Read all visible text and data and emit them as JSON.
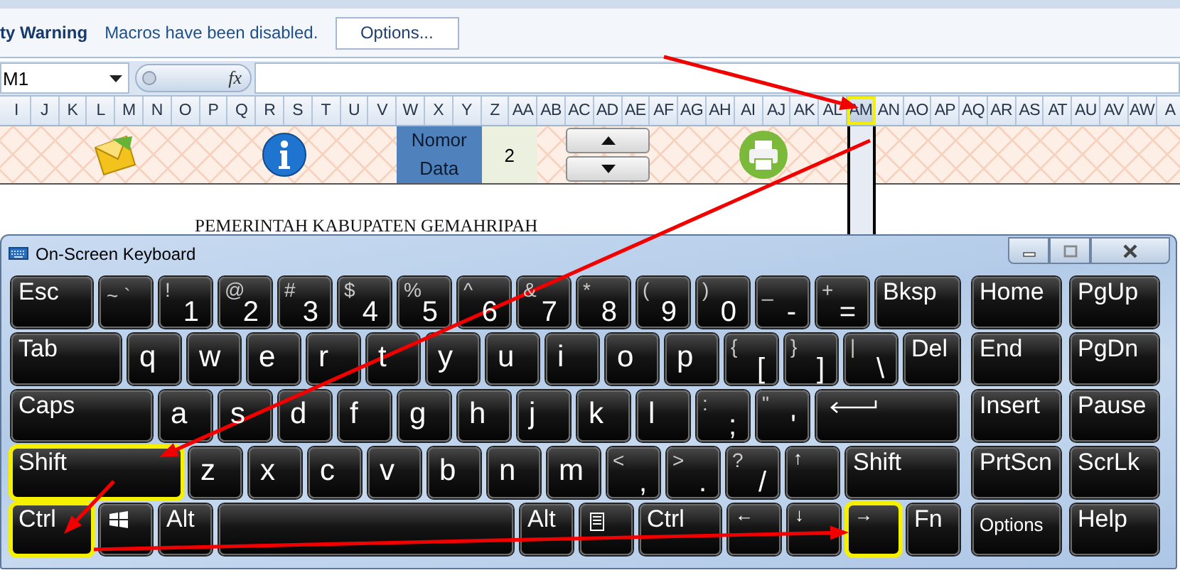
{
  "security_bar": {
    "title": "ty Warning",
    "message": "Macros have been disabled.",
    "button": "Options..."
  },
  "formula_bar": {
    "name_box": "M1",
    "function_label": "fx"
  },
  "column_headers": [
    {
      "label": "I",
      "selected": false,
      "highlighted": false
    },
    {
      "label": "J",
      "selected": false,
      "highlighted": false
    },
    {
      "label": "K",
      "selected": false,
      "highlighted": false
    },
    {
      "label": "L",
      "selected": false,
      "highlighted": false
    },
    {
      "label": "M",
      "selected": false,
      "highlighted": false
    },
    {
      "label": "N",
      "selected": false,
      "highlighted": false
    },
    {
      "label": "O",
      "selected": false,
      "highlighted": false
    },
    {
      "label": "P",
      "selected": false,
      "highlighted": false
    },
    {
      "label": "Q",
      "selected": false,
      "highlighted": false
    },
    {
      "label": "R",
      "selected": false,
      "highlighted": false
    },
    {
      "label": "S",
      "selected": false,
      "highlighted": false
    },
    {
      "label": "T",
      "selected": false,
      "highlighted": false
    },
    {
      "label": "U",
      "selected": false,
      "highlighted": false
    },
    {
      "label": "V",
      "selected": false,
      "highlighted": false
    },
    {
      "label": "W",
      "selected": false,
      "highlighted": false
    },
    {
      "label": "X",
      "selected": false,
      "highlighted": false
    },
    {
      "label": "Y",
      "selected": false,
      "highlighted": false
    },
    {
      "label": "Z",
      "selected": false,
      "highlighted": false
    },
    {
      "label": "AA",
      "selected": false,
      "highlighted": false
    },
    {
      "label": "AB",
      "selected": false,
      "highlighted": false
    },
    {
      "label": "AC",
      "selected": false,
      "highlighted": false
    },
    {
      "label": "AD",
      "selected": false,
      "highlighted": false
    },
    {
      "label": "AE",
      "selected": false,
      "highlighted": false
    },
    {
      "label": "AF",
      "selected": false,
      "highlighted": false
    },
    {
      "label": "AG",
      "selected": false,
      "highlighted": false
    },
    {
      "label": "AH",
      "selected": false,
      "highlighted": false
    },
    {
      "label": "AI",
      "selected": false,
      "highlighted": false
    },
    {
      "label": "AJ",
      "selected": false,
      "highlighted": false
    },
    {
      "label": "AK",
      "selected": false,
      "highlighted": false
    },
    {
      "label": "AL",
      "selected": false,
      "highlighted": false
    },
    {
      "label": "AM",
      "selected": true,
      "highlighted": true
    },
    {
      "label": "AN",
      "selected": false,
      "highlighted": false
    },
    {
      "label": "AO",
      "selected": false,
      "highlighted": false
    },
    {
      "label": "AP",
      "selected": false,
      "highlighted": false
    },
    {
      "label": "AQ",
      "selected": false,
      "highlighted": false
    },
    {
      "label": "AR",
      "selected": false,
      "highlighted": false
    },
    {
      "label": "AS",
      "selected": false,
      "highlighted": false
    },
    {
      "label": "AT",
      "selected": false,
      "highlighted": false
    },
    {
      "label": "AU",
      "selected": false,
      "highlighted": false
    },
    {
      "label": "AV",
      "selected": false,
      "highlighted": false
    },
    {
      "label": "AW",
      "selected": false,
      "highlighted": false
    },
    {
      "label": "A",
      "selected": false,
      "highlighted": false
    }
  ],
  "toolbar_row": {
    "nomor_label": "Nomor Data",
    "nomor_value": "2"
  },
  "document_title": "PEMERINTAH KABUPATEN GEMAHRIPAH",
  "keyboard": {
    "title": "On-Screen Keyboard",
    "main_rows": [
      {
        "keys": [
          {
            "kind": "label",
            "label": "Esc",
            "highlighted": false
          },
          {
            "kind": "inline",
            "shift": "~",
            "label": "`",
            "highlighted": false
          },
          {
            "kind": "symbol",
            "shift": "!",
            "label": "1",
            "highlighted": false
          },
          {
            "kind": "symbol",
            "shift": "@",
            "label": "2",
            "highlighted": false
          },
          {
            "kind": "symbol",
            "shift": "#",
            "label": "3",
            "highlighted": false
          },
          {
            "kind": "symbol",
            "shift": "$",
            "label": "4",
            "highlighted": false
          },
          {
            "kind": "symbol",
            "shift": "%",
            "label": "5",
            "highlighted": false
          },
          {
            "kind": "symbol",
            "shift": "^",
            "label": "6",
            "highlighted": false
          },
          {
            "kind": "symbol",
            "shift": "&",
            "label": "7",
            "highlighted": false
          },
          {
            "kind": "symbol",
            "shift": "*",
            "label": "8",
            "highlighted": false
          },
          {
            "kind": "symbol",
            "shift": "(",
            "label": "9",
            "highlighted": false
          },
          {
            "kind": "symbol",
            "shift": ")",
            "label": "0",
            "highlighted": false
          },
          {
            "kind": "symbol",
            "shift": "_",
            "label": "-",
            "highlighted": false
          },
          {
            "kind": "symbol",
            "shift": "+",
            "label": "=",
            "highlighted": false
          },
          {
            "kind": "label",
            "label": "Bksp",
            "highlighted": false
          }
        ]
      },
      {
        "keys": [
          {
            "kind": "label",
            "label": "Tab",
            "highlighted": false
          },
          {
            "kind": "letter",
            "label": "q",
            "highlighted": false
          },
          {
            "kind": "letter",
            "label": "w",
            "highlighted": false
          },
          {
            "kind": "letter",
            "label": "e",
            "highlighted": false
          },
          {
            "kind": "letter",
            "label": "r",
            "highlighted": false
          },
          {
            "kind": "letter",
            "label": "t",
            "highlighted": false
          },
          {
            "kind": "letter",
            "label": "y",
            "highlighted": false
          },
          {
            "kind": "letter",
            "label": "u",
            "highlighted": false
          },
          {
            "kind": "letter",
            "label": "i",
            "highlighted": false
          },
          {
            "kind": "letter",
            "label": "o",
            "highlighted": false
          },
          {
            "kind": "letter",
            "label": "p",
            "highlighted": false
          },
          {
            "kind": "symbol",
            "shift": "{",
            "label": "[",
            "highlighted": false
          },
          {
            "kind": "symbol",
            "shift": "}",
            "label": "]",
            "highlighted": false
          },
          {
            "kind": "symbol",
            "shift": "|",
            "label": "\\",
            "highlighted": false
          },
          {
            "kind": "label",
            "label": "Del",
            "highlighted": false
          }
        ]
      },
      {
        "keys": [
          {
            "kind": "label",
            "label": "Caps",
            "highlighted": false
          },
          {
            "kind": "letter",
            "label": "a",
            "highlighted": false
          },
          {
            "kind": "letter",
            "label": "s",
            "highlighted": false
          },
          {
            "kind": "letter",
            "label": "d",
            "highlighted": false
          },
          {
            "kind": "letter",
            "label": "f",
            "highlighted": false
          },
          {
            "kind": "letter",
            "label": "g",
            "highlighted": false
          },
          {
            "kind": "letter",
            "label": "h",
            "highlighted": false
          },
          {
            "kind": "letter",
            "label": "j",
            "highlighted": false
          },
          {
            "kind": "letter",
            "label": "k",
            "highlighted": false
          },
          {
            "kind": "letter",
            "label": "l",
            "highlighted": false
          },
          {
            "kind": "symbol",
            "shift": ":",
            "label": ";",
            "highlighted": false
          },
          {
            "kind": "symbol",
            "shift": "\"",
            "label": "'",
            "highlighted": false
          },
          {
            "kind": "enter",
            "highlighted": false
          }
        ]
      },
      {
        "keys": [
          {
            "kind": "label",
            "label": "Shift",
            "highlighted": true
          },
          {
            "kind": "letter",
            "label": "z",
            "highlighted": false
          },
          {
            "kind": "letter",
            "label": "x",
            "highlighted": false
          },
          {
            "kind": "letter",
            "label": "c",
            "highlighted": false
          },
          {
            "kind": "letter",
            "label": "v",
            "highlighted": false
          },
          {
            "kind": "letter",
            "label": "b",
            "highlighted": false
          },
          {
            "kind": "letter",
            "label": "n",
            "highlighted": false
          },
          {
            "kind": "letter",
            "label": "m",
            "highlighted": false
          },
          {
            "kind": "symbol",
            "shift": "<",
            "label": ",",
            "highlighted": false
          },
          {
            "kind": "symbol",
            "shift": ">",
            "label": ".",
            "highlighted": false
          },
          {
            "kind": "symbol",
            "shift": "?",
            "label": "/",
            "highlighted": false
          },
          {
            "kind": "arrow",
            "label": "↑",
            "highlighted": false
          },
          {
            "kind": "label",
            "label": "Shift",
            "highlighted": false
          }
        ]
      },
      {
        "keys": [
          {
            "kind": "label",
            "label": "Ctrl",
            "highlighted": true
          },
          {
            "kind": "windows",
            "highlighted": false
          },
          {
            "kind": "label",
            "label": "Alt",
            "highlighted": false
          },
          {
            "kind": "space",
            "highlighted": false
          },
          {
            "kind": "label",
            "label": "Alt",
            "highlighted": false
          },
          {
            "kind": "menu",
            "highlighted": false
          },
          {
            "kind": "label",
            "label": "Ctrl",
            "highlighted": false
          },
          {
            "kind": "arrow",
            "label": "←",
            "highlighted": false
          },
          {
            "kind": "arrow",
            "label": "↓",
            "highlighted": false
          },
          {
            "kind": "arrow",
            "label": "→",
            "highlighted": true
          },
          {
            "kind": "label",
            "label": "Fn",
            "highlighted": false
          }
        ]
      }
    ],
    "side_rows": [
      {
        "keys": [
          {
            "kind": "label",
            "label": "Home",
            "highlighted": false
          },
          {
            "kind": "label",
            "label": "PgUp",
            "highlighted": false
          }
        ]
      },
      {
        "keys": [
          {
            "kind": "label",
            "label": "End",
            "highlighted": false
          },
          {
            "kind": "label",
            "label": "PgDn",
            "highlighted": false
          }
        ]
      },
      {
        "keys": [
          {
            "kind": "label",
            "label": "Insert",
            "highlighted": false
          },
          {
            "kind": "label",
            "label": "Pause",
            "highlighted": false
          }
        ]
      },
      {
        "keys": [
          {
            "kind": "label",
            "label": "PrtScn",
            "highlighted": false
          },
          {
            "kind": "label",
            "label": "ScrLk",
            "highlighted": false
          }
        ]
      },
      {
        "keys": [
          {
            "kind": "small",
            "label": "Options",
            "highlighted": false
          },
          {
            "kind": "label",
            "label": "Help",
            "highlighted": false
          }
        ]
      }
    ]
  }
}
